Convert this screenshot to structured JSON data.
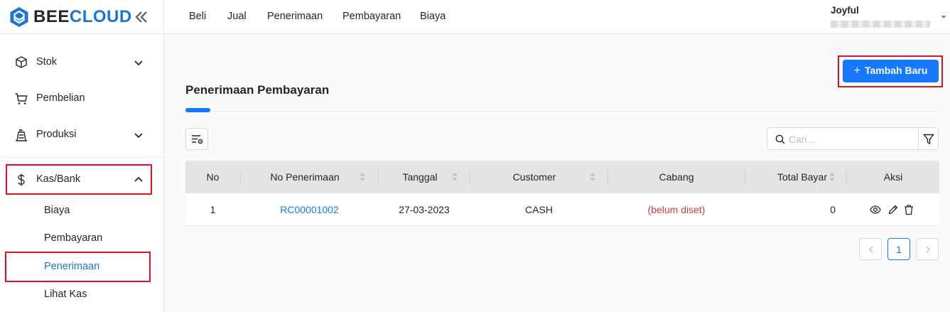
{
  "brand": {
    "name_part1": "BEE",
    "name_part2": "CLOUD",
    "accent": "#1976d2"
  },
  "sidebar": {
    "items": [
      {
        "label": "Stok",
        "icon": "cube-icon",
        "expandable": true,
        "expanded": false
      },
      {
        "label": "Pembelian",
        "icon": "cart-icon",
        "expandable": false
      },
      {
        "label": "Produksi",
        "icon": "factory-icon",
        "expandable": true,
        "expanded": false
      },
      {
        "label": "Kas/Bank",
        "icon": "dollar-icon",
        "expandable": true,
        "expanded": true
      }
    ],
    "kasbank_subitems": [
      {
        "label": "Biaya",
        "active": false
      },
      {
        "label": "Pembayaran",
        "active": false
      },
      {
        "label": "Penerimaan",
        "active": true
      },
      {
        "label": "Lihat Kas",
        "active": false
      }
    ]
  },
  "topnav": {
    "items": [
      "Beli",
      "Jual",
      "Penerimaan",
      "Pembayaran",
      "Biaya"
    ],
    "user_name": "Joyful"
  },
  "page": {
    "title": "Penerimaan Pembayaran",
    "add_button_label": "Tambah Baru",
    "search_placeholder": "Cari..."
  },
  "table": {
    "columns": [
      {
        "label": "No",
        "sortable": false
      },
      {
        "label": "No Penerimaan",
        "sortable": true
      },
      {
        "label": "Tanggal",
        "sortable": true
      },
      {
        "label": "Customer",
        "sortable": true
      },
      {
        "label": "Cabang",
        "sortable": false
      },
      {
        "label": "Total Bayar",
        "sortable": true
      },
      {
        "label": "Aksi",
        "sortable": false
      }
    ],
    "rows": [
      {
        "no": "1",
        "no_penerimaan": "RC00001002",
        "tanggal": "27-03-2023",
        "customer": "CASH",
        "cabang": "(belum diset)",
        "total_bayar": "0"
      }
    ]
  },
  "pagination": {
    "current_page": "1"
  },
  "colors": {
    "primary": "#1677ff",
    "highlight": "#e0121d",
    "unset": "#d9363e",
    "header_bg": "#e4e4e4"
  }
}
